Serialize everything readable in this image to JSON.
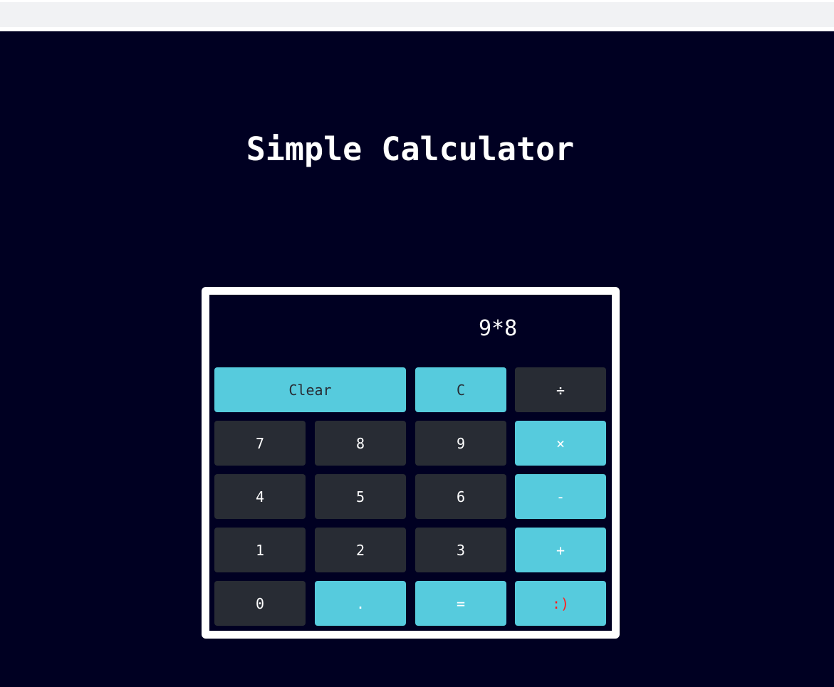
{
  "page": {
    "title": "Simple Calculator"
  },
  "display": {
    "value": "9*8"
  },
  "keys": {
    "clear": "Clear",
    "backspace": "C",
    "divide": "÷",
    "seven": "7",
    "eight": "8",
    "nine": "9",
    "multiply": "×",
    "four": "4",
    "five": "5",
    "six": "6",
    "subtract": "-",
    "one": "1",
    "two": "2",
    "three": "3",
    "add": "+",
    "zero": "0",
    "decimal": ".",
    "equals": "=",
    "smiley": ":)"
  },
  "colors": {
    "background": "#000022",
    "number_key": "#282c34",
    "accent_key": "#56cbdd",
    "smiley_text": "#ff2020",
    "frame": "#ffffff"
  }
}
